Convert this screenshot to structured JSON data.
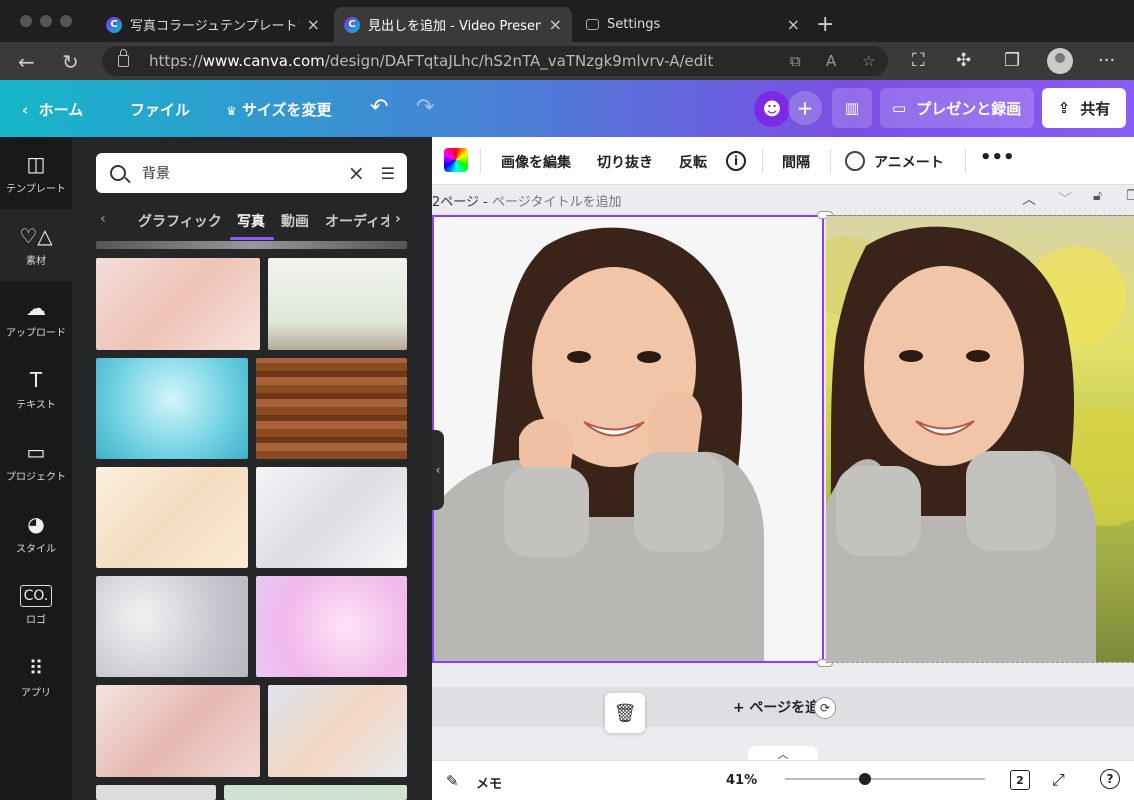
{
  "browser": {
    "tabs": [
      {
        "title": "写真コラージュテンプレートでおしゃ",
        "icon": "canva-icon",
        "active": false
      },
      {
        "title": "見出しを追加 - Video Presentation",
        "icon": "canva-icon",
        "active": true
      },
      {
        "title": "Settings",
        "icon": "settings-tab-icon",
        "active": false
      }
    ],
    "url_scheme": "https://",
    "url_host": "www.canva.com",
    "url_path": "/design/DAFTqtaJLhc/hS2nTA_vaTNzgk9mlvrv-A/edit"
  },
  "header": {
    "home": "ホーム",
    "file": "ファイル",
    "resize": "サイズを変更",
    "present": "プレゼンと録画",
    "share": "共有"
  },
  "rail": {
    "items": [
      {
        "label": "テンプレート",
        "icon": "template-icon"
      },
      {
        "label": "素材",
        "icon": "elements-icon"
      },
      {
        "label": "アップロード",
        "icon": "upload-icon"
      },
      {
        "label": "テキスト",
        "icon": "text-icon"
      },
      {
        "label": "プロジェクト",
        "icon": "folder-icon"
      },
      {
        "label": "スタイル",
        "icon": "palette-icon"
      },
      {
        "label": "ロゴ",
        "icon": "logo-icon"
      },
      {
        "label": "アプリ",
        "icon": "apps-icon"
      }
    ]
  },
  "panel": {
    "search_value": "背景",
    "categories": [
      "グラフィック",
      "写真",
      "動画",
      "オーディオ"
    ],
    "active_category": "写真"
  },
  "toolbar": {
    "edit_image": "画像を編集",
    "crop": "切り抜き",
    "flip": "反転",
    "spacing": "間隔",
    "animate": "アニメート"
  },
  "page": {
    "label": "2ページ - ",
    "title_placeholder": "ページタイトルを追加"
  },
  "canvas": {
    "add_page": "+ ページを追加"
  },
  "footer": {
    "notes": "メモ",
    "zoom": "41%",
    "zoom_fraction": 0.41,
    "page_count": "2"
  },
  "colors": {
    "accent": "#8b3dff",
    "header_start": "#16b6c9",
    "header_end": "#8b5cf6"
  }
}
